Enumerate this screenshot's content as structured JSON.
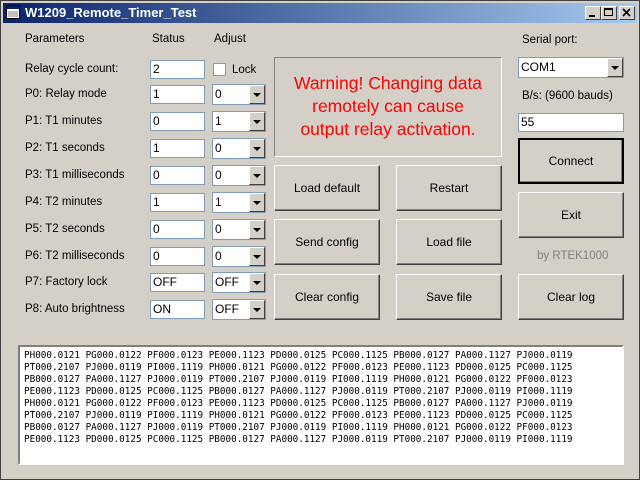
{
  "window": {
    "title": "W1209_Remote_Timer_Test"
  },
  "headers": {
    "parameters": "Parameters",
    "status": "Status",
    "adjust": "Adjust"
  },
  "params": [
    {
      "label": "Relay cycle count:",
      "status": "2"
    },
    {
      "label": "P0: Relay mode",
      "status": "1",
      "adjust": "0"
    },
    {
      "label": "P1: T1 minutes",
      "status": "0",
      "adjust": "1"
    },
    {
      "label": "P2: T1 seconds",
      "status": "1",
      "adjust": "0"
    },
    {
      "label": "P3: T1 milliseconds",
      "status": "0",
      "adjust": "0"
    },
    {
      "label": "P4: T2 minutes",
      "status": "1",
      "adjust": "1"
    },
    {
      "label": "P5: T2 seconds",
      "status": "0",
      "adjust": "0"
    },
    {
      "label": "P6: T2 milliseconds",
      "status": "0",
      "adjust": "0"
    },
    {
      "label": "P7: Factory lock",
      "status": "OFF",
      "adjust": "OFF"
    },
    {
      "label": "P8: Auto brightness",
      "status": "ON",
      "adjust": "OFF"
    }
  ],
  "lock_label": "Lock",
  "warning": "Warning! Changing data\nremotely can cause\noutput relay activation.",
  "buttons": {
    "load_default": "Load default",
    "restart": "Restart",
    "send_config": "Send config",
    "load_file": "Load file",
    "clear_config": "Clear config",
    "save_file": "Save file",
    "connect": "Connect",
    "exit": "Exit",
    "clear_log": "Clear log"
  },
  "serial": {
    "port_label": "Serial port:",
    "port_value": "COM1",
    "bauds_label": "B/s: (9600 bauds)",
    "bauds_value": "55"
  },
  "credit": "by RTEK1000",
  "log_lines": [
    "PH000.0121 PG000.0122 PF000.0123 PE000.1123 PD000.0125 PC000.1125 PB000.0127 PA000.1127 PJ000.0119",
    "PT000.2107 PJ000.0119 PI000.1119 PH000.0121 PG000.0122 PF000.0123 PE000.1123 PD000.0125 PC000.1125",
    "PB000.0127 PA000.1127 PJ000.0119 PT000.2107 PJ000.0119 PI000.1119 PH000.0121 PG000.0122 PF000.0123",
    "PE000.1123 PD000.0125 PC000.1125 PB000.0127 PA000.1127 PJ000.0119 PT000.2107 PJ000.0119 PI000.1119",
    "PH000.0121 PG000.0122 PF000.0123 PE000.1123 PD000.0125 PC000.1125 PB000.0127 PA000.1127 PJ000.0119",
    "PT000.2107 PJ000.0119 PI000.1119 PH000.0121 PG000.0122 PF000.0123 PE000.1123 PD000.0125 PC000.1125",
    "PB000.0127 PA000.1127 PJ000.0119 PT000.2107 PJ000.0119 PI000.1119 PH000.0121 PG000.0122 PF000.0123",
    "PE000.1123 PD000.0125 PC000.1125 PB000.0127 PA000.1127 PJ000.0119 PT000.2107 PJ000.0119 PI000.1119"
  ],
  "colors": {
    "title_bar": "#0a246a",
    "warning_text": "#ff0000",
    "window_bg": "#d4d0c8"
  }
}
